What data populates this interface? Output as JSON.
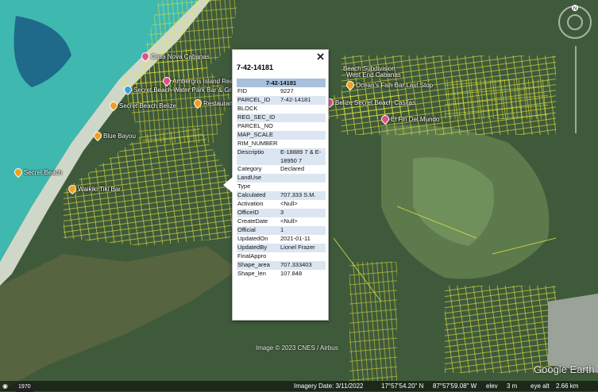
{
  "places": [
    {
      "label": "Casa Nova Cabanas",
      "color": "p"
    },
    {
      "label": "Ambergris Island Realty",
      "color": "p"
    },
    {
      "label": "Secret Beach Water Park Bar & Grill",
      "color": "b"
    },
    {
      "label": "Secret Beach Belize",
      "color": "o"
    },
    {
      "label": "Restaurant",
      "color": "o"
    },
    {
      "label": "Blue Bayou",
      "color": "o"
    },
    {
      "label": "Secret Beach",
      "color": "o"
    },
    {
      "label": "Waikiki Tiki Bar",
      "color": "o"
    },
    {
      "label": "Beach Subdivision",
      "color": "o"
    },
    {
      "label": "West End Cabanas",
      "color": "o"
    },
    {
      "label": "Ocean's Fish Bar Last Stop",
      "color": "o"
    },
    {
      "label": "Belize Secret Beach Casitas",
      "color": "p"
    },
    {
      "label": "El Fin Del Mundo",
      "color": "p"
    }
  ],
  "popup": {
    "title": "7-42-14181",
    "header": "7-42-14181",
    "rows": [
      [
        "FID",
        "9227"
      ],
      [
        "PARCEL_ID",
        "7-42-14181"
      ],
      [
        "BLOCK",
        ""
      ],
      [
        "REG_SEC_ID",
        ""
      ],
      [
        "PARCEL_NO",
        ""
      ],
      [
        "MAP_SCALE",
        ""
      ],
      [
        "RIM_NUMBER",
        ""
      ],
      [
        "Descriptio",
        "E-18889 7 & E-18950 7"
      ],
      [
        "Category",
        "Declared"
      ],
      [
        "LandUse",
        ""
      ],
      [
        "Type",
        ""
      ],
      [
        "Calculated",
        "707.333 S.M."
      ],
      [
        "Activation",
        "<Null>"
      ],
      [
        "OfficeID",
        "3"
      ],
      [
        "CreateDate",
        "<Null>"
      ],
      [
        "Official",
        "1"
      ],
      [
        "UpdatedOn",
        "2021-01-11"
      ],
      [
        "UpdatedBy",
        "Lionel Frazer"
      ],
      [
        "FinalAppro",
        ""
      ],
      [
        "Shape_area",
        "707.333403"
      ],
      [
        "Shape_len",
        "107.848"
      ]
    ]
  },
  "credit": "Image © 2023 CNES / Airbus",
  "logo": "Google Earth",
  "status": {
    "year": "1970",
    "imagery": "Imagery Date: 3/11/2022",
    "lat": "17°57'54.20\" N",
    "lon": "87°57'59.08\" W",
    "elev_label": "elev",
    "elev": "3 m",
    "eye": "eye alt",
    "eye_val": "2.66 km"
  },
  "colors": {
    "parcel": "#e6e640",
    "water": "#3fb8b0",
    "land": "#3f5a3a"
  }
}
